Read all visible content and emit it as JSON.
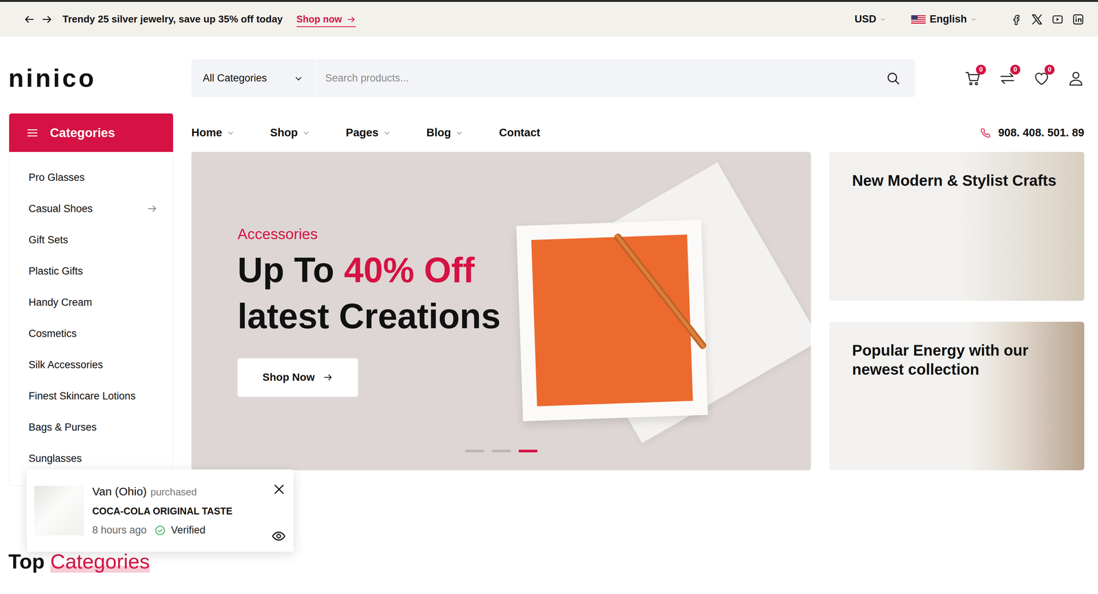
{
  "topbar": {
    "announcement": "Trendy 25 silver jewelry, save up 35% off today",
    "link": "Shop now",
    "currency": "USD",
    "language": "English"
  },
  "logo": "ninico",
  "search": {
    "category": "All Categories",
    "placeholder": "Search products..."
  },
  "header_badges": {
    "cart": "0",
    "compare": "0",
    "wishlist": "0"
  },
  "categories": {
    "title": "Categories",
    "items": [
      {
        "label": "Pro Glasses",
        "expandable": false
      },
      {
        "label": "Casual Shoes",
        "expandable": true
      },
      {
        "label": "Gift Sets",
        "expandable": false
      },
      {
        "label": "Plastic Gifts",
        "expandable": false
      },
      {
        "label": "Handy Cream",
        "expandable": false
      },
      {
        "label": "Cosmetics",
        "expandable": false
      },
      {
        "label": "Silk Accessories",
        "expandable": false
      },
      {
        "label": "Finest Skincare Lotions",
        "expandable": false
      },
      {
        "label": "Bags & Purses",
        "expandable": false
      },
      {
        "label": "Sunglasses",
        "expandable": false
      }
    ]
  },
  "nav": [
    {
      "label": "Home",
      "dropdown": true
    },
    {
      "label": "Shop",
      "dropdown": true
    },
    {
      "label": "Pages",
      "dropdown": true
    },
    {
      "label": "Blog",
      "dropdown": true
    },
    {
      "label": "Contact",
      "dropdown": false
    }
  ],
  "phone": "908. 408. 501. 89",
  "hero": {
    "eyebrow": "Accessories",
    "title_lead": "Up To",
    "title_highlight": "40% Off",
    "title_rest": "latest Creations",
    "button": "Shop Now",
    "slides": [
      {
        "selected": false
      },
      {
        "selected": false
      },
      {
        "selected": true
      }
    ]
  },
  "banners": [
    {
      "title": "New Modern & Stylist Crafts"
    },
    {
      "title": "Popular Energy with our newest collection"
    }
  ],
  "purchase_popup": {
    "name": "Van (Ohio)",
    "action": "purchased",
    "product": "COCA-COLA ORIGINAL TASTE",
    "time": "8 hours ago",
    "status": "Verified",
    "verified": true
  },
  "section_title": {
    "lead": "Top",
    "highlight": "Categories"
  }
}
